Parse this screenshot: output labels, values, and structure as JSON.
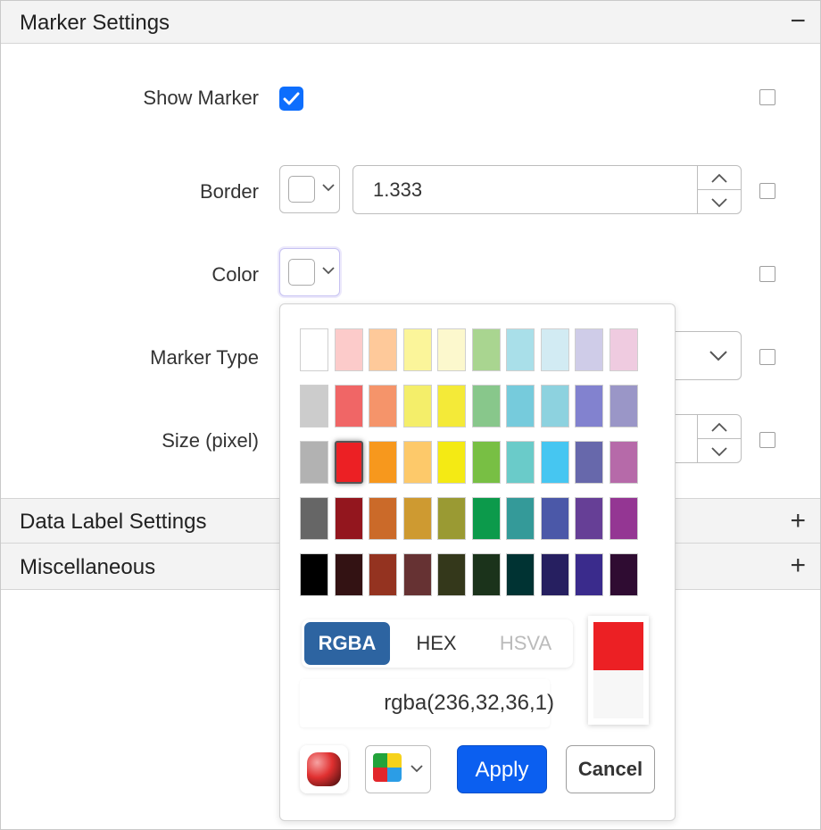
{
  "marker_settings": {
    "title": "Marker Settings",
    "toggle": "−",
    "rows": {
      "show_marker": "Show Marker",
      "border": "Border",
      "border_width": "1.333",
      "color": "Color",
      "marker_type": "Marker Type",
      "size": "Size (pixel)"
    }
  },
  "data_label_settings": {
    "title": "Data Label Settings",
    "toggle": "+"
  },
  "miscellaneous": {
    "title": "Miscellaneous",
    "toggle": "+"
  },
  "color_picker": {
    "palette_rows": [
      [
        "#ffffff",
        "#fccbca",
        "#fec99a",
        "#fbf59a",
        "#fcf8cd",
        "#a9d590",
        "#a9dfe9",
        "#d2ebf3",
        "#cfcce8",
        "#efcbe0"
      ],
      [
        "#cccccc",
        "#f06666",
        "#f5946a",
        "#f4ee6a",
        "#f4ea38",
        "#88c78b",
        "#76cbdc",
        "#8dd2df",
        "#8282cf",
        "#9a96c7"
      ],
      [
        "#b2b2b2",
        "#ec2024",
        "#f7981d",
        "#fdc96a",
        "#f4ea14",
        "#78bf44",
        "#6acbc9",
        "#46c6f1",
        "#6768ab",
        "#b66aa9"
      ],
      [
        "#666666",
        "#93161e",
        "#cb6a29",
        "#ce9a31",
        "#9a9a33",
        "#0c9a4b",
        "#349a99",
        "#4b58a8",
        "#663f96",
        "#943693"
      ],
      [
        "#000000",
        "#331213",
        "#943320",
        "#663233",
        "#34381b",
        "#1b331b",
        "#003333",
        "#261f60",
        "#3a2b8c",
        "#2f0c32"
      ]
    ],
    "selected": {
      "row": 2,
      "col": 1
    },
    "modes": {
      "rgba": "RGBA",
      "hex": "HEX",
      "hsva": "HSVA"
    },
    "value": "rgba(236,32,36,1)",
    "current_color": "#ec2024",
    "apply_label": "Apply",
    "cancel_label": "Cancel"
  }
}
